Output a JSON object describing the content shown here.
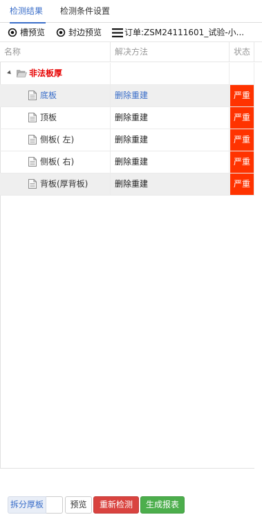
{
  "tabs": [
    {
      "label": "检测结果",
      "active": true
    },
    {
      "label": "检测条件设置",
      "active": false
    }
  ],
  "toolbar": {
    "slot_preview": "槽预览",
    "edge_preview": "封边预览",
    "order": "订单:ZSM24111601_试验-小..."
  },
  "grid": {
    "columns": [
      "名称",
      "解决方法",
      "状态"
    ],
    "group": {
      "label": "非法板厚",
      "expanded": true
    },
    "rows": [
      {
        "name": "底板",
        "method": "删除重建",
        "status": "严重",
        "selected": true
      },
      {
        "name": "顶板",
        "method": "删除重建",
        "status": "严重",
        "selected": false
      },
      {
        "name": "侧板( 左)",
        "method": "删除重建",
        "status": "严重",
        "selected": false
      },
      {
        "name": "侧板( 右)",
        "method": "删除重建",
        "status": "严重",
        "selected": false
      },
      {
        "name": "背板(厚背板)",
        "method": "删除重建",
        "status": "严重",
        "selected": false
      }
    ]
  },
  "colors": {
    "accent": "#3a6ec9",
    "group_label": "#e60000",
    "status_severe": "#ff3300",
    "redetect_button": "#d9433f",
    "report_button": "#4cae4c"
  },
  "icons": {
    "tree_toggle": "expand-arrow-icon",
    "group": "folder-open-icon",
    "item": "file-icon",
    "preview": "eye-icon",
    "order": "menu-icon"
  },
  "footer": {
    "split_label": "拆分厚板",
    "split_value": "",
    "preview_label": "预览",
    "redetect_label": "重新检测",
    "report_label": "生成报表"
  }
}
